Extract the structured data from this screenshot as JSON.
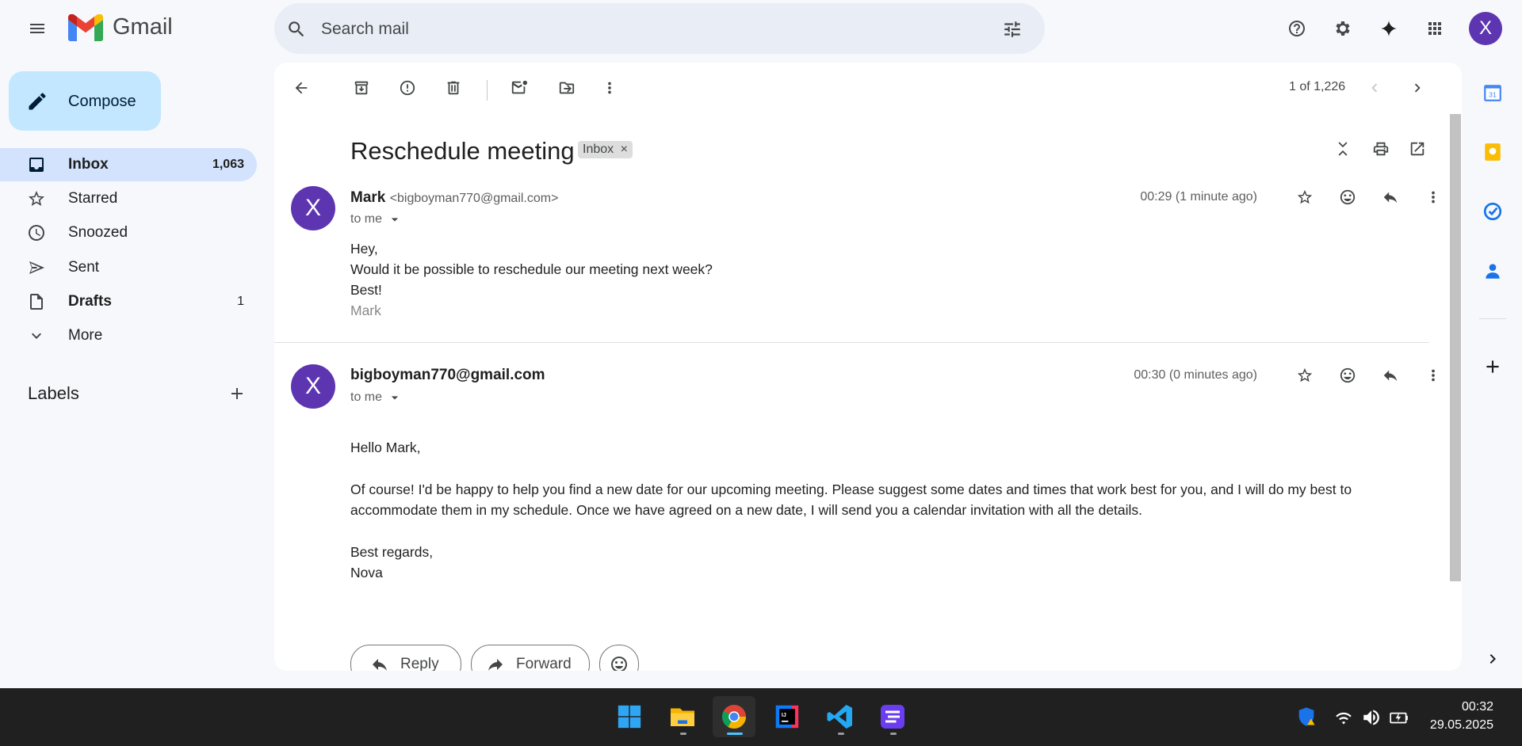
{
  "header": {
    "app_name": "Gmail",
    "search_placeholder": "Search mail",
    "avatar_letter": "X",
    "icons": [
      "menu-icon",
      "help-icon",
      "settings-icon",
      "gemini-icon",
      "apps-icon"
    ]
  },
  "sidebar": {
    "compose_label": "Compose",
    "items": [
      {
        "label": "Inbox",
        "count": "1,063",
        "icon": "inbox-icon"
      },
      {
        "label": "Starred",
        "count": "",
        "icon": "star-icon"
      },
      {
        "label": "Snoozed",
        "count": "",
        "icon": "clock-icon"
      },
      {
        "label": "Sent",
        "count": "",
        "icon": "send-icon"
      },
      {
        "label": "Drafts",
        "count": "1",
        "icon": "draft-icon"
      },
      {
        "label": "More",
        "count": "",
        "icon": "chevron-down-icon"
      }
    ],
    "labels_title": "Labels"
  },
  "toolbar": {
    "pager_text": "1 of 1,226"
  },
  "thread": {
    "subject": "Reschedule meeting",
    "chip": "Inbox",
    "chip_close": "×",
    "messages": [
      {
        "avatar_letter": "X",
        "sender_name": "Mark",
        "sender_email": "<bigboyman770@gmail.com>",
        "to": "to me",
        "time": "00:29 (1 minute ago)",
        "lines": [
          "Hey,",
          "Would it be possible to reschedule our meeting next week?",
          "Best!"
        ],
        "signature": "Mark"
      },
      {
        "avatar_letter": "X",
        "sender_name": "bigboyman770@gmail.com",
        "to": "to me",
        "time": "00:30 (0 minutes ago)",
        "lines": [
          "Hello Mark,",
          "Of course! I'd be happy to help you find a new date for our upcoming meeting. Please suggest some dates and times that work best for you, and I will do my best to",
          "accommodate them in my schedule. Once we have agreed on a new date, I will send you a calendar invitation with all the details.",
          "Best regards,",
          "Nova"
        ]
      }
    ],
    "reply_label": "Reply",
    "forward_label": "Forward"
  },
  "taskbar": {
    "time": "00:32",
    "date": "29.05.2025",
    "apps": [
      "windows-start-icon",
      "file-explorer-icon",
      "chrome-icon",
      "intellij-icon",
      "vscode-icon",
      "app-icon"
    ]
  }
}
